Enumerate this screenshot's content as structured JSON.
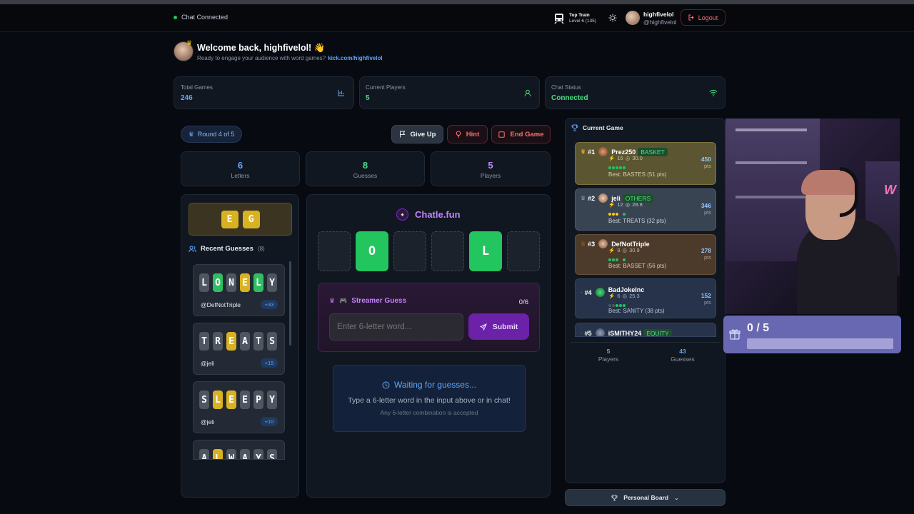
{
  "header": {
    "chat_status": "Chat Connected",
    "train_title": "Top Train",
    "train_level": "Level 6  (135)",
    "username": "highfivelol",
    "handle": "@highfivelol",
    "logout_label": "Logout"
  },
  "welcome": {
    "title": "Welcome back, highfivelol! 👋",
    "subtitle": "Ready to engage your audience with word games?",
    "link": "kick.com/highfivelol"
  },
  "stats": [
    {
      "label": "Total Games",
      "value": "246"
    },
    {
      "label": "Current Players",
      "value": "5"
    },
    {
      "label": "Chat Status",
      "value": "Connected"
    }
  ],
  "game": {
    "round": "Round 4 of 5",
    "give_up": "Give Up",
    "hint": "Hint",
    "end_game": "End Game",
    "letters_value": "6",
    "letters_label": "Letters",
    "guesses_value": "8",
    "guesses_label": "Guesses",
    "players_value": "5",
    "players_label": "Players",
    "hint_letters": [
      "E",
      "G"
    ],
    "logo": "Chatle.fun",
    "board": [
      "",
      "O",
      "",
      "",
      "L",
      ""
    ],
    "streamer_guess_label": "Streamer Guess",
    "streamer_guess_count": "0/6",
    "input_placeholder": "Enter 6-letter word...",
    "submit_label": "Submit",
    "waiting_title": "Waiting for guesses...",
    "waiting_text": "Type a 6-letter word in the input above or in chat!",
    "waiting_sub": "Any 6-letter combination is accepted"
  },
  "recent": {
    "title": "Recent Guesses",
    "count": "(8)",
    "items": [
      {
        "letters": [
          "L",
          "O",
          "N",
          "E",
          "L",
          "Y"
        ],
        "user": "@DefNotTriple",
        "points": "+33"
      },
      {
        "letters": [
          "T",
          "R",
          "E",
          "A",
          "T",
          "S"
        ],
        "user": "@jeli",
        "points": "+15"
      },
      {
        "letters": [
          "S",
          "L",
          "E",
          "E",
          "P",
          "Y"
        ],
        "user": "@jeli",
        "points": "+10"
      },
      {
        "letters": [
          "A",
          "L",
          "W",
          "A",
          "Y",
          "S"
        ],
        "user": "",
        "points": ""
      }
    ]
  },
  "leaderboard": {
    "title": "Current Game",
    "entries": [
      {
        "rank": "#1",
        "name": "Prez250",
        "word": "BASKET",
        "streak": "15",
        "avg": "30.0",
        "best": "Best: BASTES (51 pts)",
        "points": "450",
        "unit": "pts"
      },
      {
        "rank": "#2",
        "name": "jeli",
        "word": "OTHERS",
        "streak": "12",
        "avg": "28.8",
        "best": "Best: TREATS (32 pts)",
        "points": "346",
        "unit": "pts"
      },
      {
        "rank": "#3",
        "name": "DefNotTriple",
        "word": "",
        "streak": "9",
        "avg": "30.9",
        "best": "Best: BASSET (56 pts)",
        "points": "278",
        "unit": "pts"
      },
      {
        "rank": "#4",
        "name": "BadJokeInc",
        "word": "",
        "streak": "6",
        "avg": "25.3",
        "best": "Best: SANITY (38 pts)",
        "points": "152",
        "unit": "pts"
      },
      {
        "rank": "#5",
        "name": "iSMITHY24",
        "word": "EQUITY",
        "streak": "",
        "avg": "",
        "best": "",
        "points": "",
        "unit": ""
      }
    ],
    "players_value": "5",
    "players_label": "Players",
    "guesses_value": "43",
    "guesses_label": "Guesses",
    "personal_board": "Personal Board"
  },
  "overlay": {
    "progress": "0 / 5",
    "fraction": 0
  },
  "colors": {
    "green": "#22c55e",
    "yellow": "#d9b223",
    "purple": "#7e22ce",
    "danger": "#f87171"
  }
}
